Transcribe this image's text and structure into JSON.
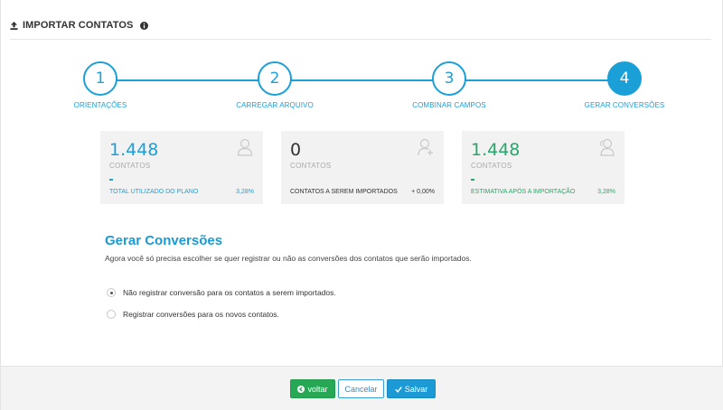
{
  "header": {
    "title": "IMPORTAR CONTATOS",
    "upload_icon": "upload-icon",
    "info_icon": "info-icon"
  },
  "colors": {
    "accent": "#1ba0d8",
    "success": "#27a855",
    "card_bg": "#f2f2f2"
  },
  "steps": [
    {
      "number": "1",
      "label": "ORIENTAÇÕES"
    },
    {
      "number": "2",
      "label": "CARREGAR ARQUIVO"
    },
    {
      "number": "3",
      "label": "COMBINAR CAMPOS"
    },
    {
      "number": "4",
      "label": "GERAR CONVERSÕES",
      "active": true
    }
  ],
  "cards": [
    {
      "value": "1.448",
      "unit": "CONTATOS",
      "foot_label": "TOTAL UTILIZADO DO PLANO",
      "foot_value": "3,28%",
      "color": "#1ba0d8",
      "icon": "user-icon"
    },
    {
      "value": "0",
      "unit": "CONTATOS",
      "foot_label": "CONTATOS A SEREM IMPORTADOS",
      "foot_value": "+ 0,00%",
      "color": "#333333",
      "icon": "user-add-icon"
    },
    {
      "value": "1.448",
      "unit": "CONTATOS",
      "foot_label": "ESTIMATIVA APÓS A IMPORTAÇÃO",
      "foot_value": "3,28%",
      "color": "#27a86b",
      "icon": "users-icon"
    }
  ],
  "section": {
    "title": "Gerar Conversões",
    "description": "Agora você só precisa escolher se quer registrar ou não as conversões dos contatos que serão importados."
  },
  "options": [
    {
      "label": "Não registrar conversão para os contatos a serem importados.",
      "checked": true
    },
    {
      "label": "Registrar conversões para os novos contatos.",
      "checked": false
    }
  ],
  "footer": {
    "back_label": "voltar",
    "cancel_label": "Cancelar",
    "save_label": "Salvar"
  }
}
